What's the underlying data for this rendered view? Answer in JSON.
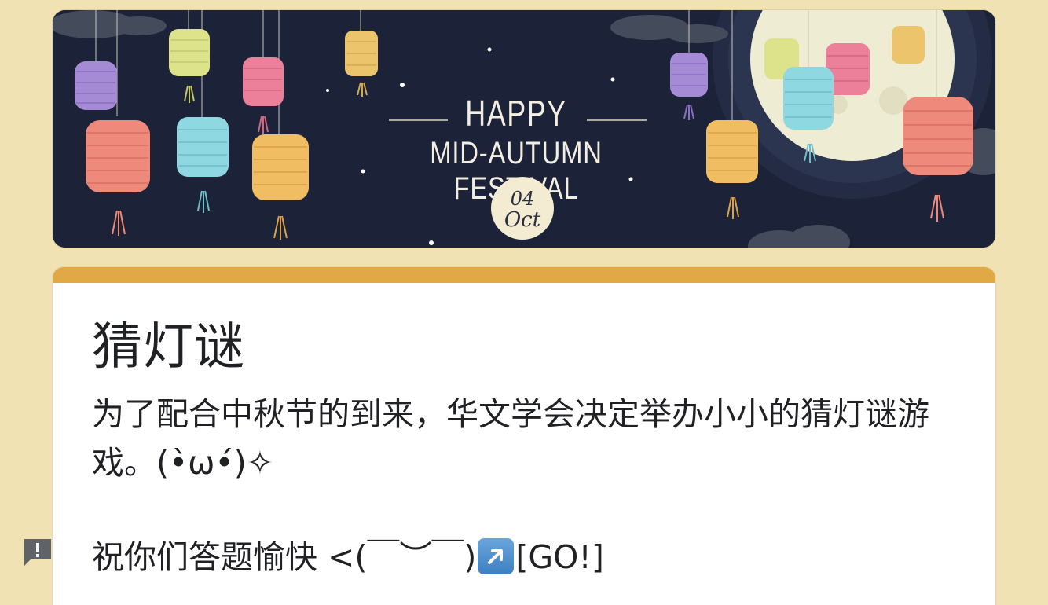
{
  "banner": {
    "happy_text": "HAPPY",
    "festival_text": "MID-AUTUMN FESTIVAL",
    "date_day": "04",
    "date_month": "Oct"
  },
  "form": {
    "title": "猜灯谜",
    "description": "为了配合中秋节的到来，华文学会决定举办小小的猜灯谜游戏。(•̀ω•́)✧",
    "wish_text": "祝你们答题愉快 <(￣︶￣)",
    "go_icon": "up-right-arrow-icon",
    "go_text": "[GO!]"
  },
  "feedback": {
    "icon": "report-issue-icon"
  },
  "colors": {
    "page_background": "#f1e2b4",
    "accent": "#e1a846",
    "banner_background": "#1c2338",
    "moon": "#efecd4"
  }
}
